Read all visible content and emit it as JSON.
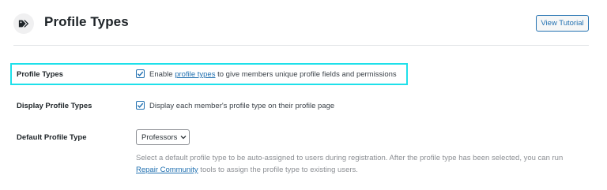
{
  "header": {
    "title": "Profile Types",
    "icon": "tag-icon",
    "tutorial_button": "View Tutorial"
  },
  "colors": {
    "accent": "#2271b1",
    "highlight": "#1ee0ea",
    "muted_text": "#8c8f94"
  },
  "settings": {
    "profile_types": {
      "label": "Profile Types",
      "checked": true,
      "text_before": "Enable ",
      "link": "profile types",
      "text_after": " to give members unique profile fields and permissions"
    },
    "display_profile_types": {
      "label": "Display Profile Types",
      "checked": true,
      "text": "Display each member's profile type on their profile page"
    },
    "default_profile_type": {
      "label": "Default Profile Type",
      "selected": "Professors",
      "description_line1": "Select a default profile type to be auto-assigned to users during registration. After the profile type has been selected, you can run",
      "description_link": "Repair Community",
      "description_after_link": " tools to assign the profile type to existing users."
    }
  }
}
